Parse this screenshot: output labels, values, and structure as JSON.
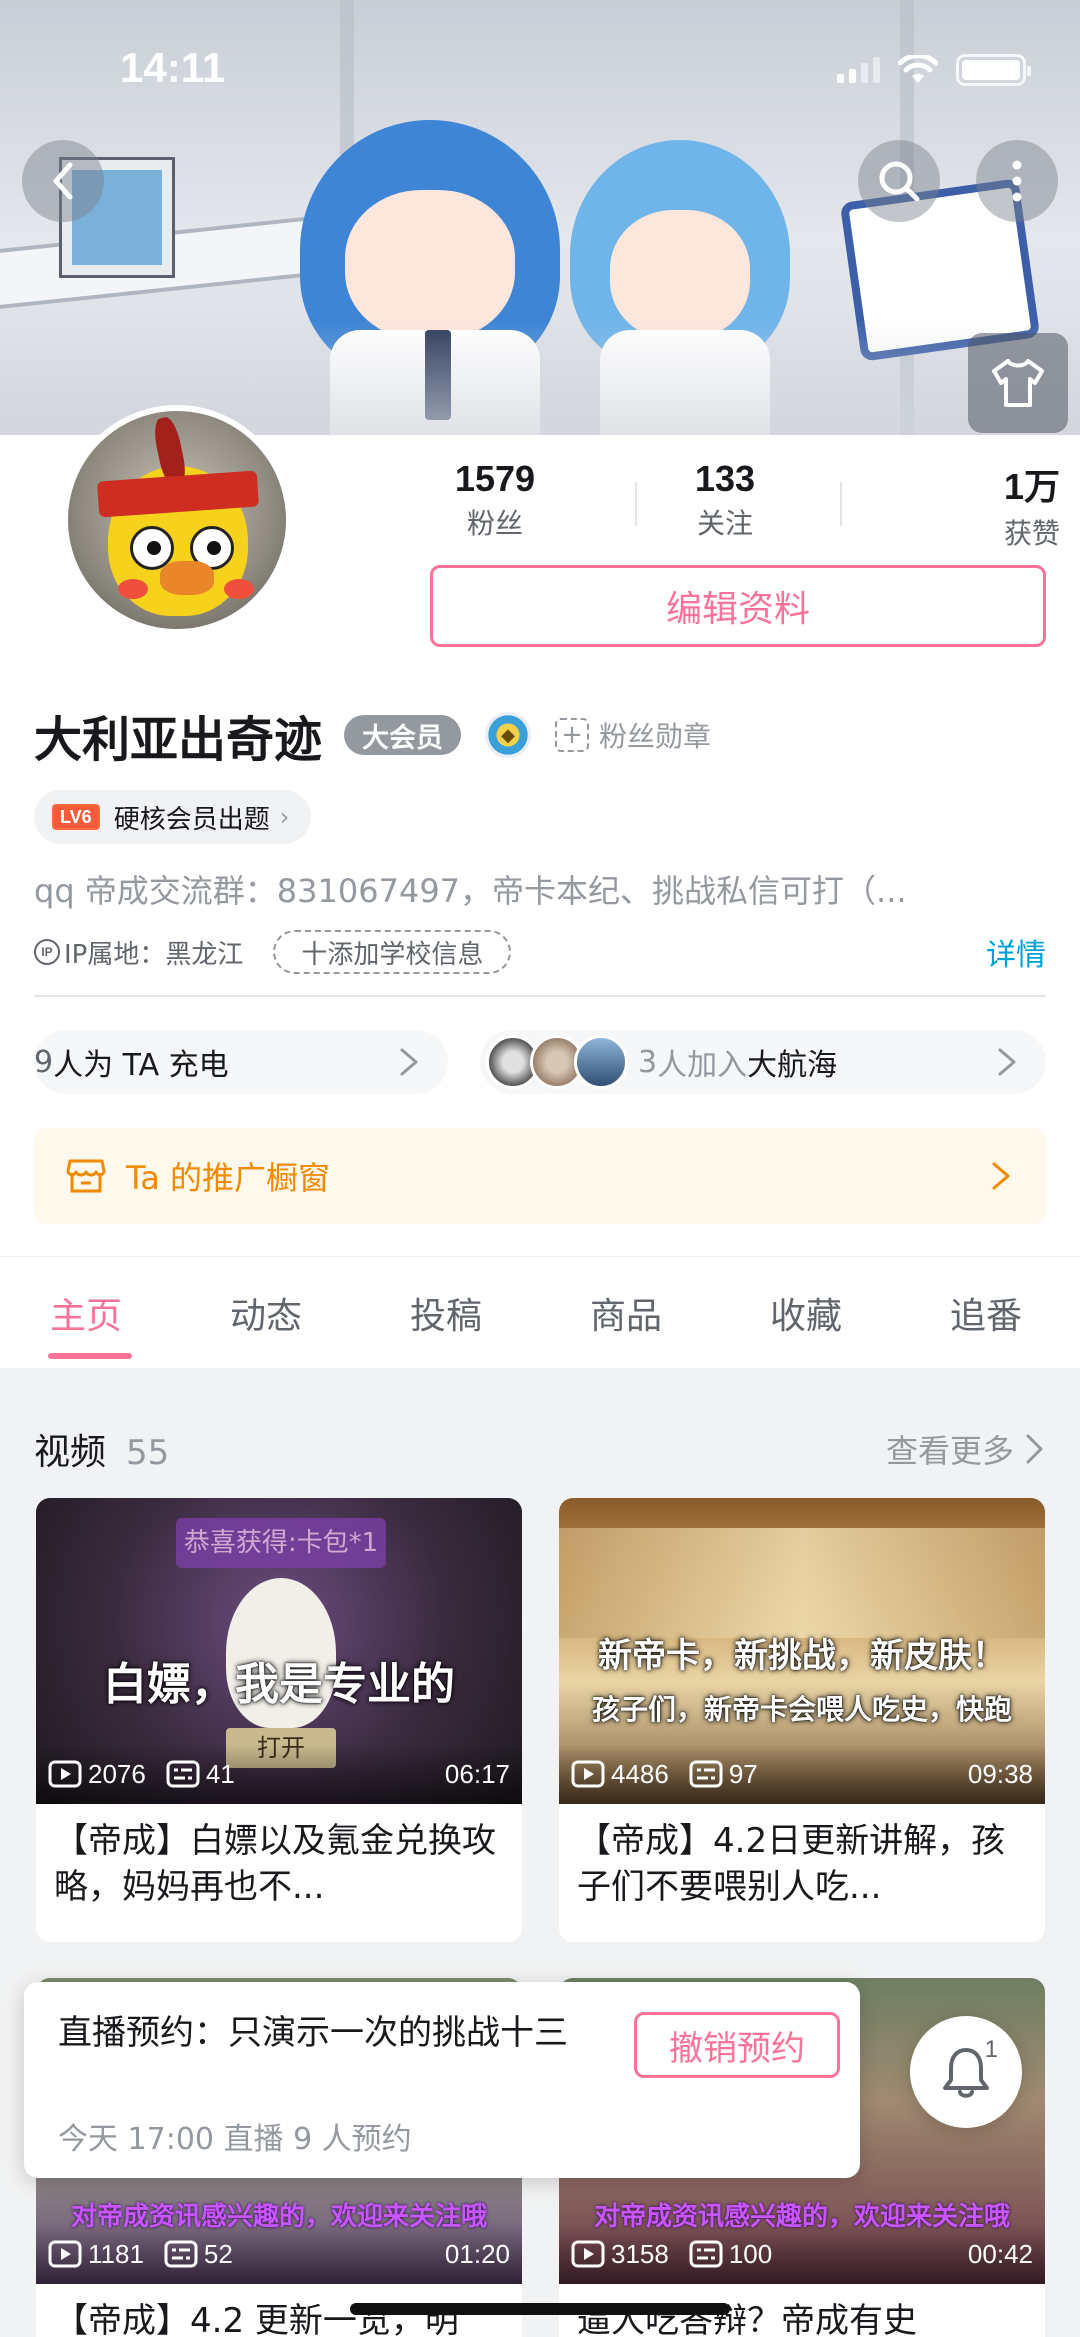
{
  "status_bar": {
    "time": "14:11"
  },
  "profile": {
    "stats": [
      {
        "value": "1579",
        "label": "粉丝"
      },
      {
        "value": "133",
        "label": "关注"
      },
      {
        "value": "1万",
        "label": "获赞"
      }
    ],
    "edit_label": "编辑资料",
    "name": "大利亚出奇迹",
    "vip_label": "大会员",
    "fan_medal_label": "粉丝勋章",
    "level_badge": "LV6",
    "level_chip_text": "硬核会员出题",
    "bio": "qq 帝成交流群：831067497，帝卡本纪、挑战私信可打（...",
    "ip_label": "IP属地：黑龙江",
    "school_label": "十添加学校信息",
    "detail_label": "详情",
    "charge": {
      "count": "9",
      "text": "人为 TA 充电"
    },
    "fleet": {
      "count": "3",
      "text": "人加入",
      "name": "大航海"
    },
    "shop_window": "Ta 的推广橱窗"
  },
  "tabs": [
    {
      "label": "主页",
      "active": true
    },
    {
      "label": "动态",
      "active": false
    },
    {
      "label": "投稿",
      "active": false
    },
    {
      "label": "商品",
      "active": false
    },
    {
      "label": "收藏",
      "active": false
    },
    {
      "label": "追番",
      "active": false
    }
  ],
  "videos_section": {
    "title": "视频",
    "count": "55",
    "more": "查看更多"
  },
  "videos": [
    {
      "caption": "白嫖，我是专业的",
      "thumb_text": "恭喜获得:卡包*1",
      "button_text": "打开",
      "plays": "2076",
      "danmaku": "41",
      "duration": "06:17",
      "title": "【帝成】白嫖以及氪金兑换攻略，妈妈再也不..."
    },
    {
      "caption": "新帝卡，新挑战，新皮肤！",
      "caption2": "孩子们，新帝卡会喂人吃史，快跑",
      "plays": "4486",
      "danmaku": "97",
      "duration": "09:38",
      "title": "【帝成】4.2日更新讲解，孩子们不要喂别人吃..."
    },
    {
      "overlay": "对帝成资讯感兴趣的，欢迎来关注哦",
      "plays": "1181",
      "danmaku": "52",
      "duration": "01:20",
      "title": "【帝成】4.2 更新一览，明"
    },
    {
      "overlay": "对帝成资讯感兴趣的，欢迎来关注哦",
      "plays": "3158",
      "danmaku": "100",
      "duration": "00:42",
      "title": "逼人吃答辩？帝成有史"
    }
  ],
  "live_reservation": {
    "title": "直播预约：只演示一次的挑战十三",
    "subtitle": "今天 17:00 直播   9 人预约",
    "cancel_label": "撤销预约",
    "bell_count": "1"
  },
  "colors": {
    "accent": "#fb7299",
    "link": "#00a1d6",
    "shop": "#f08a00"
  }
}
